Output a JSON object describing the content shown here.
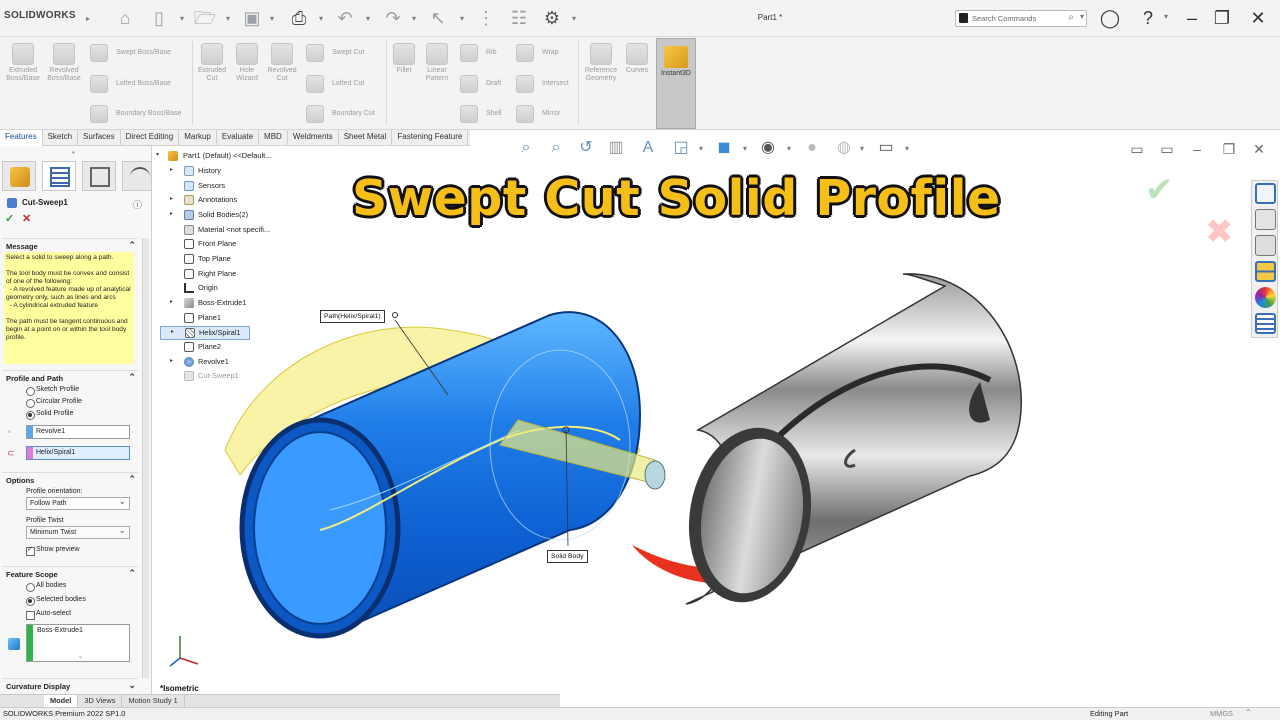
{
  "app": {
    "brand": "SOLIDWORKS",
    "doc_title": "Part1 *"
  },
  "search": {
    "placeholder": "Search Commands"
  },
  "ribbon": {
    "extruded_boss": "Extruded Boss/Base",
    "revolved_boss": "Revolved Boss/Base",
    "swept_boss": "Swept Boss/Base",
    "lofted_boss": "Lofted Boss/Base",
    "boundary_boss": "Boundary Boss/Base",
    "extruded_cut": "Extruded Cut",
    "hole_wizard": "Hole Wizard",
    "revolved_cut": "Revolved Cut",
    "swept_cut": "Swept Cut",
    "lofted_cut": "Lofted Cut",
    "boundary_cut": "Boundary Cut",
    "fillet": "Fillet",
    "linear_pattern": "Linear Pattern",
    "rib": "Rib",
    "draft": "Draft",
    "shell": "Shell",
    "wrap": "Wrap",
    "intersect": "Intersect",
    "mirror": "Mirror",
    "reference_geometry": "Reference Geometry",
    "curves": "Curves",
    "instant3d": "Instant3D"
  },
  "tabs": [
    "Features",
    "Sketch",
    "Surfaces",
    "Direct Editing",
    "Markup",
    "Evaluate",
    "MBD",
    "Weldments",
    "Sheet Metal",
    "Fastening Feature"
  ],
  "panel": {
    "feature_title": "Cut-Sweep1",
    "message_header": "Message",
    "message_text": "Select a solid to sweep along a path.\n\nThe tool body must be convex and consist of one of the following:\n  - A revolved feature made up of analytical geometry only, such as lines and arcs\n  - A cylindrical extruded feature\n\nThe path must be tangent continuous and begin at a point on or within the tool body profile.",
    "profile_header": "Profile and Path",
    "radio_sketch": "Sketch Profile",
    "radio_circular": "Circular Profile",
    "radio_solid": "Solid Profile",
    "profile_value": "Revolve1",
    "path_value": "Helix/Spiral1",
    "options_header": "Options",
    "orientation_label": "Profile orientation:",
    "orientation_value": "Follow Path",
    "twist_label": "Profile Twist",
    "twist_value": "Minimum Twist",
    "show_preview": "Show preview",
    "scope_header": "Feature Scope",
    "all_bodies": "All bodies",
    "selected_bodies": "Selected bodies",
    "auto_select": "Auto-select",
    "body_value": "Boss-Extrude1",
    "curvature_header": "Curvature Display"
  },
  "tree": {
    "root": "Part1 (Default) <<Default...",
    "items": [
      "History",
      "Sensors",
      "Annotations",
      "Solid Bodies(2)",
      "Material <not specifi...",
      "Front Plane",
      "Top Plane",
      "Right Plane",
      "Origin",
      "Boss-Extrude1",
      "Plane1",
      "Helix/Spiral1",
      "Plane2",
      "Revolve1",
      "Cut-Sweep1"
    ]
  },
  "viewport": {
    "overlay_title": "Swept Cut Solid Profile",
    "callout_path": "Path(Helix/Spiral1)",
    "callout_body": "Solid Body",
    "view_label": "*Isometric"
  },
  "bottom_tabs": [
    "Model",
    "3D Views",
    "Motion Study 1"
  ],
  "status": {
    "left": "SOLIDWORKS Premium 2022 SP1.0",
    "mode": "Editing Part",
    "units": "MMGS"
  },
  "colors": {
    "accent": "#f5bf17",
    "tool_blue": "#1e6fe0",
    "arrow_red": "#e8321e"
  }
}
